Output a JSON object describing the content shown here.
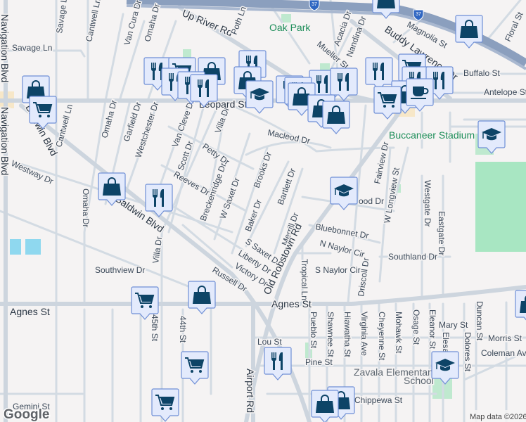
{
  "map": {
    "attribution": "Map data ©2026",
    "logo": "Google",
    "highway_shield": "37",
    "parks": [
      "Oak Park",
      "Buccaneer Stadium"
    ],
    "school_label": [
      "Zavala Elementary",
      "School"
    ],
    "streets": {
      "up_river_rd": "Up River Rd",
      "poth_ln": "Poth Ln",
      "savage_ln": "Savage Ln",
      "savage_ln2": "Savage Ln",
      "cantwell_ln": "Cantwell Ln",
      "cantwell_ln2": "Cantwell Ln",
      "van_cura_dr": "Van Cura Dr",
      "omaha_dr": "Omaha Dr",
      "omaha_dr2": "Omaha Dr",
      "omaha_dr3": "Omaha Dr",
      "navigation_blvd": "Navigation Blvd",
      "navigation_blvd2": "Navigation Blvd",
      "baldwin_blvd": "Baldwin Blvd",
      "baldwin_blvd2": "Baldwin Blvd",
      "westway_dr": "Westway Dr",
      "garfield_dr": "Garfield Dr",
      "westchester_dr": "Westchester Dr",
      "van_cleve_dr": "Van Cleve Dr",
      "villa_dr": "Villa Dr",
      "villa_dr2": "Villa Dr",
      "scott_dr": "Scott Dr",
      "petty_dr": "Petty Dr",
      "reeves_dr": "Reeves Dr",
      "breckenridge_dr": "Breckenridge Dr",
      "w_saxet_dr": "W Saxet Dr",
      "brooks_dr": "Brooks Dr",
      "macleod_dr": "Macleod Dr",
      "bartlett_dr": "Bartlett Dr",
      "baker_dr": "Baker Dr",
      "s_saxet_dr": "S Saxet Dr",
      "merrill_dr": "Merrill Dr",
      "liberty_dr": "Liberty Dr",
      "victory_dr": "Victory Dr",
      "russell_dr": "Russell Dr",
      "southview_dr": "Southview Dr",
      "agnes_st": "Agnes St",
      "agnes_st2": "Agnes St",
      "old_robstown_rd": "Old Robstown Rd",
      "acacia_dr": "Acacia Dr",
      "nandina_dr": "Nandina Dr",
      "mueller_st": "Mueller St",
      "magnolia_st": "Magnolia St",
      "buddy_lawrence_dr": "Buddy Lawrence Dr",
      "buffalo_st": "Buffalo St",
      "antelope_st": "Antelope St",
      "floral_st": "Floral St",
      "fairview_dr": "Fairview Dr",
      "w_longview_st": "W Longview St",
      "westgate_dr": "Westgate Dr",
      "eastgate_dr": "Eastgate Dr",
      "bluebonnet_dr": "Bluebonnet Dr",
      "n_naylor_cir": "N Naylor Cir",
      "southland_dr": "Southland Dr",
      "s_naylor_cir": "S Naylor Cir",
      "tropical_ln": "Tropical Ln",
      "driscoll_dr": "Driscoll Dr",
      "pueblo_st": "Pueblo St",
      "shawnee_st": "Shawnee St",
      "hiawatha_st": "Hiawatha St",
      "virginia_ave": "Virginia Ave",
      "cheyenne_st": "Cheyenne St",
      "mohawk_st": "Mohawk St",
      "osage_st": "Osage St",
      "eleanor_st": "Eleanor St",
      "elesa": "Elesa",
      "dolores_st": "Dolores St",
      "duncan_st": "Duncan St",
      "mary_st": "Mary St",
      "morris_st": "Morris St",
      "coleman_ave": "Coleman Ave",
      "lou_st": "Lou St",
      "pine_st": "Pine St",
      "chippewa_st": "Chippewa St",
      "st_45th": "45th St",
      "st_44th": "44th St",
      "gemini_st": "Gemini St",
      "airport_rd": "Airport Rd",
      "leopard_st": "Leopard St",
      "ood_dr": "ood Dr"
    },
    "colors": {
      "marker_fill": "#e3eafc",
      "marker_border": "#6f8fd6",
      "marker_icon": "#0d4467",
      "park": "#a8e6c2"
    },
    "poi_types": [
      "restaurant-icon",
      "shopping-bag-icon",
      "grocery-cart-icon",
      "school-icon",
      "cafe-cup-icon"
    ]
  }
}
